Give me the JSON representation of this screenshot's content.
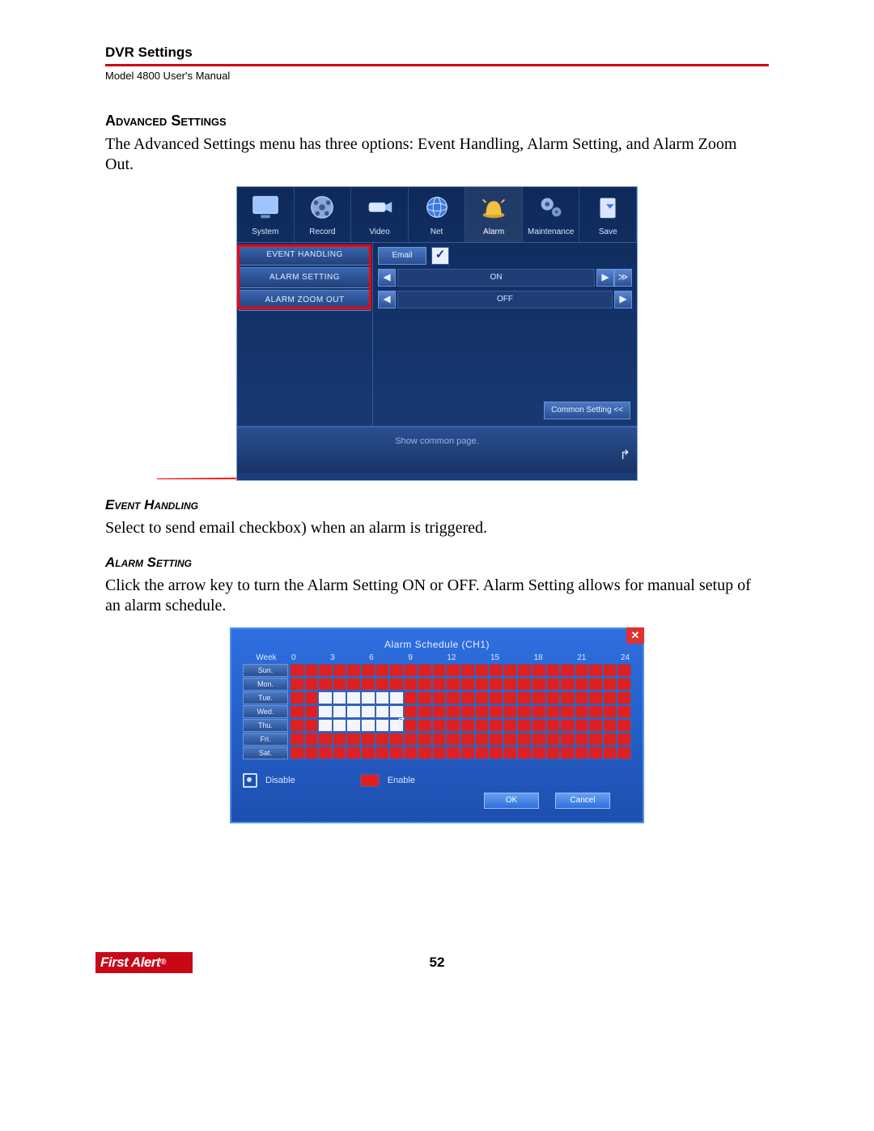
{
  "header": {
    "title": "DVR Settings",
    "subtitle": "Model 4800 User's Manual"
  },
  "section_heading": "Advanced Settings",
  "intro_text": "The Advanced Settings menu has three options: Event Handling, Alarm Setting, and Alarm Zoom Out.",
  "shot1": {
    "tabs": [
      "System",
      "Record",
      "Video",
      "Net",
      "Alarm",
      "Maintenance",
      "Save"
    ],
    "active_tab_index": 4,
    "side_items": [
      "EVENT HANDLING",
      "ALARM SETTING",
      "ALARM ZOOM OUT"
    ],
    "email_label": "Email",
    "email_checked": "✓",
    "row_on": "ON",
    "row_off": "OFF",
    "arrow_left": "◀",
    "arrow_right": "▶",
    "arrow_dbl": "≫",
    "common_button": "Common Setting <<",
    "status_text": "Show common page."
  },
  "event_handling": {
    "heading": "Event Handling",
    "text": "Select to send email checkbox) when an alarm is triggered."
  },
  "alarm_setting": {
    "heading": "Alarm Setting",
    "text": "Click the arrow key to turn the Alarm Setting ON or OFF. Alarm Setting allows for manual setup of an alarm schedule."
  },
  "shot2": {
    "title": "Alarm Schedule (CH1)",
    "week_label": "Week",
    "hours": [
      "0",
      "3",
      "6",
      "9",
      "12",
      "15",
      "18",
      "21",
      "24"
    ],
    "days": [
      "Sun.",
      "Mon.",
      "Tue.",
      "Wed.",
      "Thu.",
      "Fri.",
      "Sat."
    ],
    "schedule_off_ranges": {
      "Tue.": [
        2,
        8
      ],
      "Wed.": [
        2,
        8
      ],
      "Thu.": [
        2,
        8
      ]
    },
    "legend_disable": "Disable",
    "legend_enable": "Enable",
    "ok": "OK",
    "cancel": "Cancel",
    "close": "✕"
  },
  "footer": {
    "logo_text": "First Alert",
    "page_number": "52"
  }
}
